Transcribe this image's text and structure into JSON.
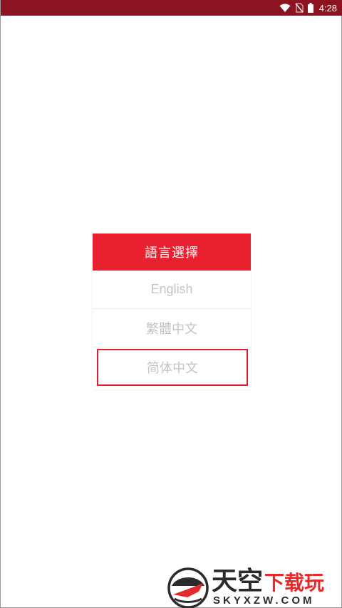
{
  "status_bar": {
    "time": "4:28",
    "icons": [
      "wifi-icon",
      "no-sim-icon",
      "battery-icon"
    ]
  },
  "dialog": {
    "title": "語言選擇",
    "options": [
      {
        "label": "English"
      },
      {
        "label": "繁體中文"
      },
      {
        "label": "简体中文",
        "highlighted": true
      }
    ]
  },
  "watermark": {
    "brand_main": "天空",
    "brand_accent": "下载玩",
    "domain": "SKYXZW.COM"
  },
  "colors": {
    "status_bar": "#8c1420",
    "dialog_header": "#e8202f",
    "highlight_border": "#e0202f",
    "option_text": "#c4c4c4"
  }
}
